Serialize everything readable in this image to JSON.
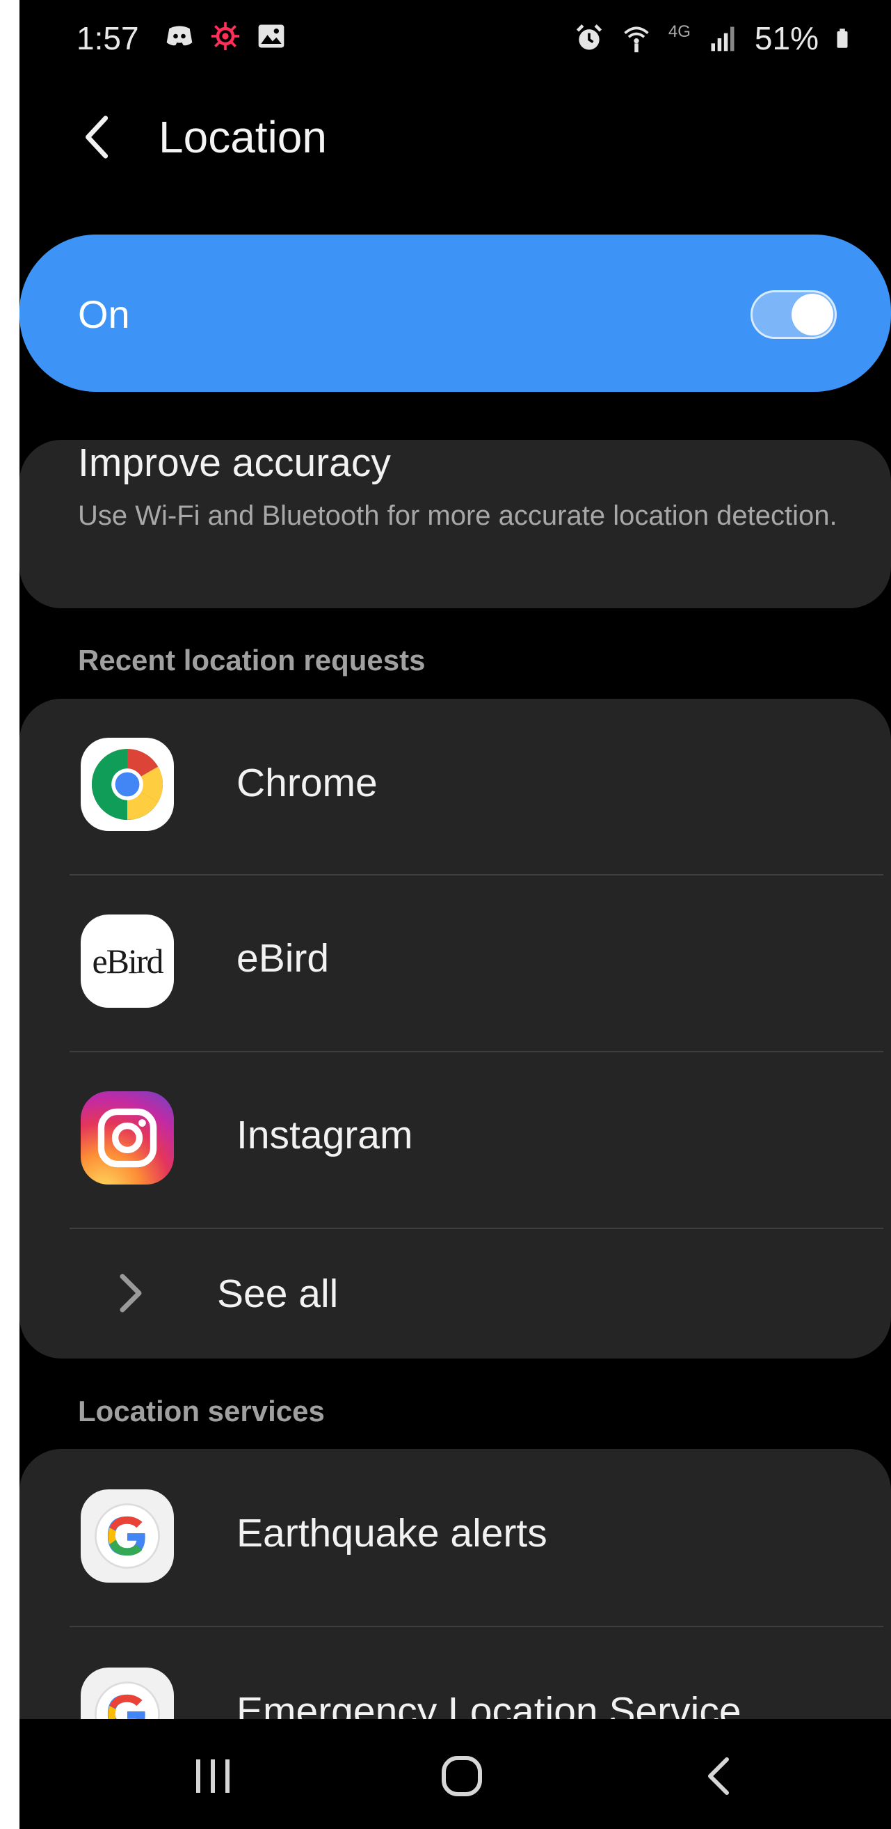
{
  "status_bar": {
    "time": "1:57",
    "network": "4G",
    "battery": "51%",
    "left_icons": [
      "discord-icon",
      "virus-icon",
      "image-icon"
    ],
    "right_icons": [
      "alarm-icon",
      "wifi-calling-icon",
      "lte-icon",
      "signal-icon",
      "battery-icon"
    ]
  },
  "header": {
    "title": "Location"
  },
  "master": {
    "label": "On",
    "enabled": true,
    "accent": "#3d94f6"
  },
  "improve": {
    "title": "Improve accuracy",
    "description": "Use Wi-Fi and Bluetooth for more accurate location detection."
  },
  "recent": {
    "header": "Recent location requests",
    "apps": [
      {
        "name": "Chrome",
        "icon": "chrome-icon"
      },
      {
        "name": "eBird",
        "icon": "ebird-icon",
        "icon_text": "eBird"
      },
      {
        "name": "Instagram",
        "icon": "instagram-icon"
      }
    ],
    "see_all": "See all"
  },
  "services": {
    "header": "Location services",
    "items": [
      {
        "name": "Earthquake alerts",
        "icon": "google-icon"
      },
      {
        "name": "Emergency Location Service",
        "icon": "google-icon"
      }
    ]
  },
  "nav": {
    "buttons": [
      "recent-apps-icon",
      "home-icon",
      "back-icon"
    ]
  }
}
